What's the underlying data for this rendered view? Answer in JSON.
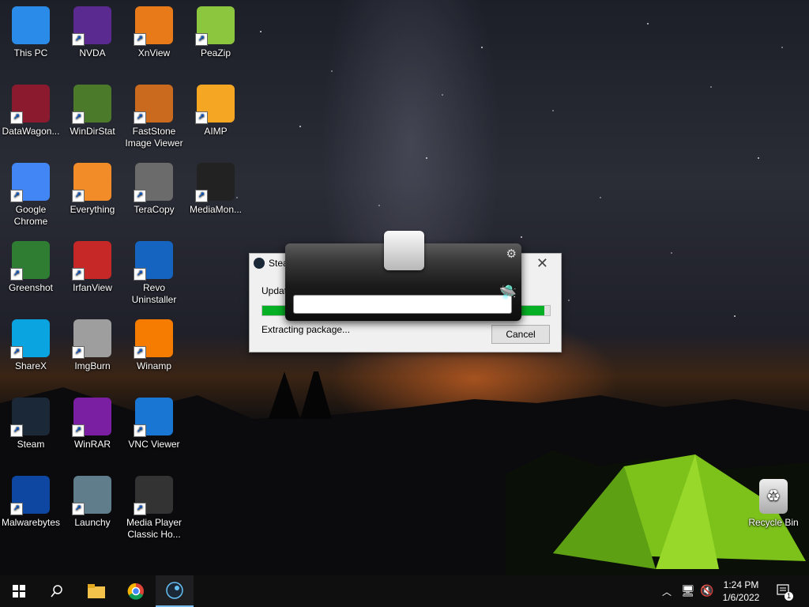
{
  "desktop": {
    "icons": [
      {
        "label": "This PC",
        "icon": "this-pc-icon"
      },
      {
        "label": "NVDA",
        "icon": "nvda-icon"
      },
      {
        "label": "XnView",
        "icon": "xnview-icon"
      },
      {
        "label": "PeaZip",
        "icon": "peazip-icon"
      },
      {
        "label": "DataWagon...",
        "icon": "datawagon-icon"
      },
      {
        "label": "WinDirStat",
        "icon": "windirstat-icon"
      },
      {
        "label": "FastStone Image Viewer",
        "icon": "faststone-icon"
      },
      {
        "label": "AIMP",
        "icon": "aimp-icon"
      },
      {
        "label": "Google Chrome",
        "icon": "chrome-icon"
      },
      {
        "label": "Everything",
        "icon": "everything-icon"
      },
      {
        "label": "TeraCopy",
        "icon": "teracopy-icon"
      },
      {
        "label": "MediaMon...",
        "icon": "mediamonkey-icon"
      },
      {
        "label": "Greenshot",
        "icon": "greenshot-icon"
      },
      {
        "label": "IrfanView",
        "icon": "irfanview-icon"
      },
      {
        "label": "Revo Uninstaller",
        "icon": "revo-icon"
      },
      {
        "label": "ShareX",
        "icon": "sharex-icon"
      },
      {
        "label": "ImgBurn",
        "icon": "imgburn-icon"
      },
      {
        "label": "Winamp",
        "icon": "winamp-icon"
      },
      {
        "label": "Steam",
        "icon": "steam-icon"
      },
      {
        "label": "WinRAR",
        "icon": "winrar-icon"
      },
      {
        "label": "VNC Viewer",
        "icon": "vnc-icon"
      },
      {
        "label": "Malwarebytes",
        "icon": "malwarebytes-icon"
      },
      {
        "label": "Launchy",
        "icon": "launchy-icon"
      },
      {
        "label": "Media Player Classic Ho...",
        "icon": "mpc-icon"
      }
    ],
    "recycle_bin": {
      "label": "Recycle Bin",
      "icon": "recycle-bin-icon"
    }
  },
  "steam_updater": {
    "title": "Stea",
    "status_label": "Updat",
    "progress": 0.98,
    "detail": "Extracting package...",
    "cancel_label": "Cancel",
    "close_glyph": "✕"
  },
  "launchy": {
    "input_value": "",
    "settings_glyph": "⚙"
  },
  "taskbar": {
    "time": "1:24 PM",
    "date": "1/6/2022",
    "notification_count": "1",
    "colors": {
      "accent": "#76b9ed",
      "background": "#0f0f10"
    }
  }
}
